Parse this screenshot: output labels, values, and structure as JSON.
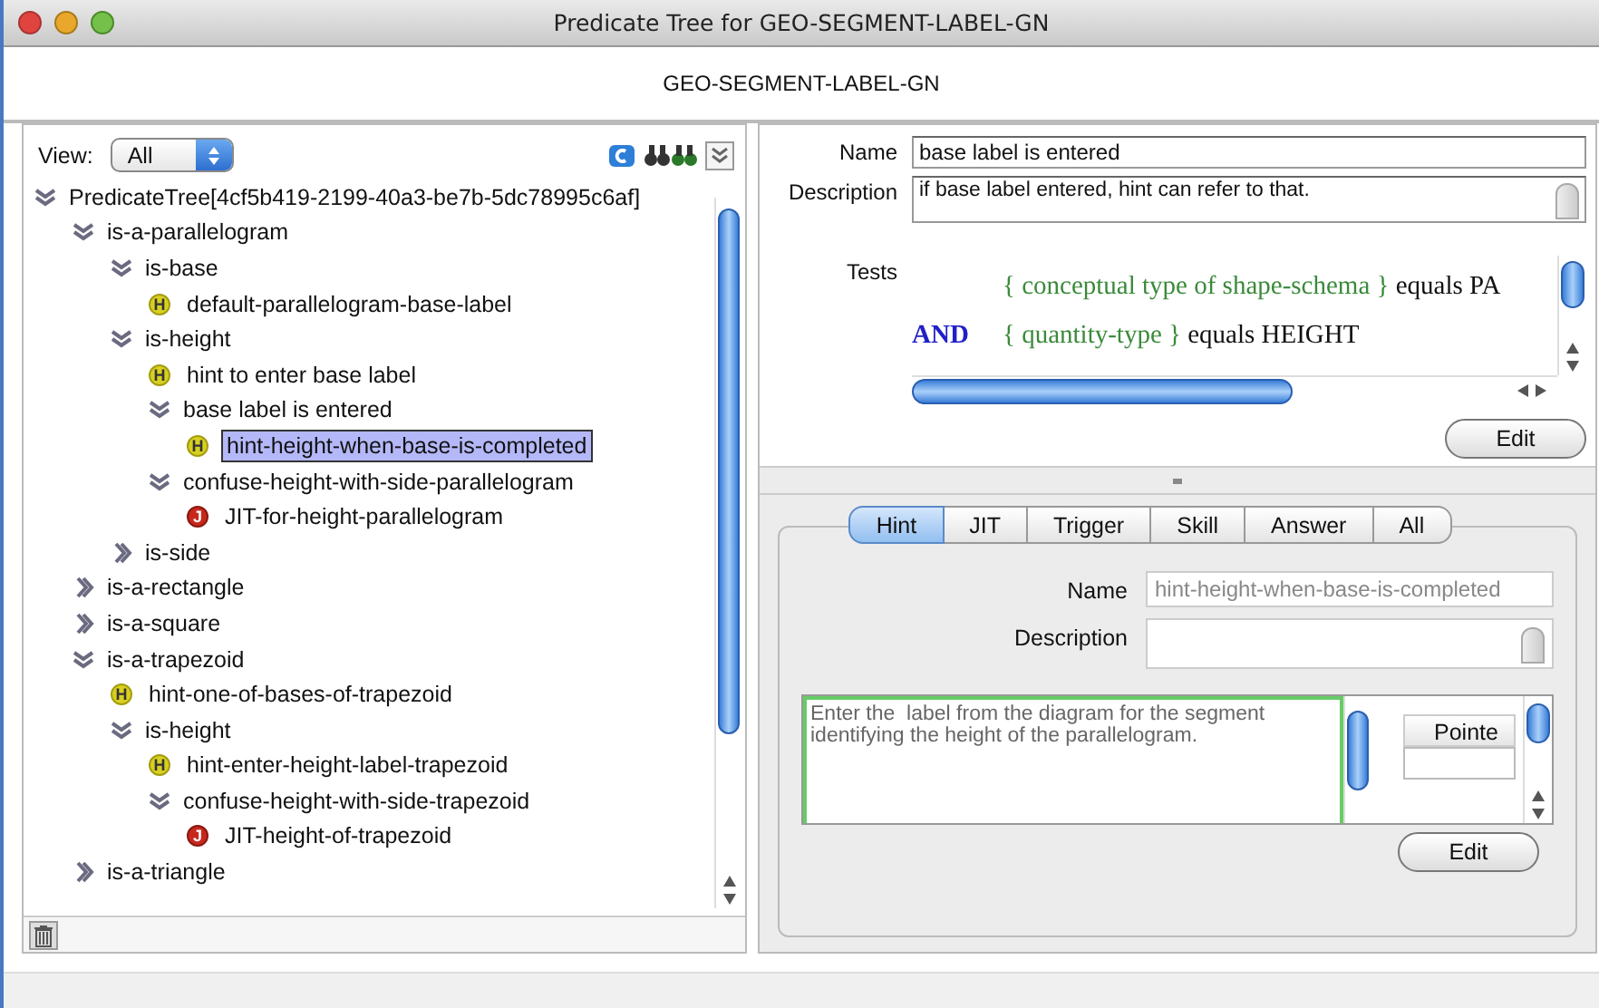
{
  "window": {
    "title": "Predicate Tree for GEO-SEGMENT-LABEL-GN"
  },
  "header": "GEO-SEGMENT-LABEL-GN",
  "tree_panel": {
    "view_label": "View:",
    "view_select": "All",
    "tree": [
      {
        "label": "PredicateTree[4cf5b419-2199-40a3-be7b-5dc78995c6af]",
        "kind": "group",
        "expanded": true,
        "selected": false,
        "children": [
          {
            "label": "is-a-parallelogram",
            "kind": "group",
            "expanded": true,
            "selected": false,
            "children": [
              {
                "label": "is-base",
                "kind": "group",
                "expanded": true,
                "selected": false,
                "children": [
                  {
                    "label": "default-parallelogram-base-label",
                    "kind": "hint",
                    "badge": "H",
                    "selected": false
                  }
                ]
              },
              {
                "label": "is-height",
                "kind": "group",
                "expanded": true,
                "selected": false,
                "children": [
                  {
                    "label": "hint to enter base label",
                    "kind": "hint",
                    "badge": "H",
                    "selected": false
                  },
                  {
                    "label": "base label is entered",
                    "kind": "group",
                    "expanded": true,
                    "selected": false,
                    "children": [
                      {
                        "label": "hint-height-when-base-is-completed",
                        "kind": "hint",
                        "badge": "H",
                        "selected": true
                      }
                    ]
                  },
                  {
                    "label": "confuse-height-with-side-parallelogram",
                    "kind": "group",
                    "expanded": true,
                    "selected": false,
                    "children": [
                      {
                        "label": "JIT-for-height-parallelogram",
                        "kind": "jit",
                        "badge": "J",
                        "selected": false
                      }
                    ]
                  }
                ]
              },
              {
                "label": "is-side",
                "kind": "group",
                "expanded": false,
                "selected": false
              }
            ]
          },
          {
            "label": "is-a-rectangle",
            "kind": "group",
            "expanded": false,
            "selected": false
          },
          {
            "label": "is-a-square",
            "kind": "group",
            "expanded": false,
            "selected": false
          },
          {
            "label": "is-a-trapezoid",
            "kind": "group",
            "expanded": true,
            "selected": false,
            "children": [
              {
                "label": "hint-one-of-bases-of-trapezoid",
                "kind": "hint",
                "badge": "H",
                "selected": false
              },
              {
                "label": "is-height",
                "kind": "group",
                "expanded": true,
                "selected": false,
                "children": [
                  {
                    "label": "hint-enter-height-label-trapezoid",
                    "kind": "hint",
                    "badge": "H",
                    "selected": false
                  },
                  {
                    "label": "confuse-height-with-side-trapezoid",
                    "kind": "group",
                    "expanded": true,
                    "selected": false,
                    "children": [
                      {
                        "label": "JIT-height-of-trapezoid",
                        "kind": "jit",
                        "badge": "J",
                        "selected": false
                      }
                    ]
                  }
                ]
              }
            ]
          },
          {
            "label": "is-a-triangle",
            "kind": "group",
            "expanded": false,
            "selected": false
          }
        ]
      }
    ]
  },
  "predicate": {
    "name_label": "Name",
    "name": "base label is entered",
    "description_label": "Description",
    "description": "if base label entered, hint can refer to that.",
    "tests_label": "Tests",
    "tests": [
      {
        "field": "{ conceptual type of shape-schema }",
        "rest": " equals PA"
      },
      {
        "connector": "AND",
        "field": "{ quantity-type }",
        "rest": " equals HEIGHT"
      }
    ],
    "edit_button": "Edit"
  },
  "detail": {
    "tabs": [
      {
        "label": "Hint",
        "selected": true
      },
      {
        "label": "JIT",
        "selected": false
      },
      {
        "label": "Trigger",
        "selected": false
      },
      {
        "label": "Skill",
        "selected": false
      },
      {
        "label": "Answer",
        "selected": false
      },
      {
        "label": "All",
        "selected": false
      }
    ],
    "name_label": "Name",
    "name": "hint-height-when-base-is-completed",
    "description_label": "Description",
    "text": "Enter the  label from the diagram for the segment identifying the height of the parallelogram.",
    "pointer_column": "Pointe",
    "edit_button": "Edit"
  }
}
